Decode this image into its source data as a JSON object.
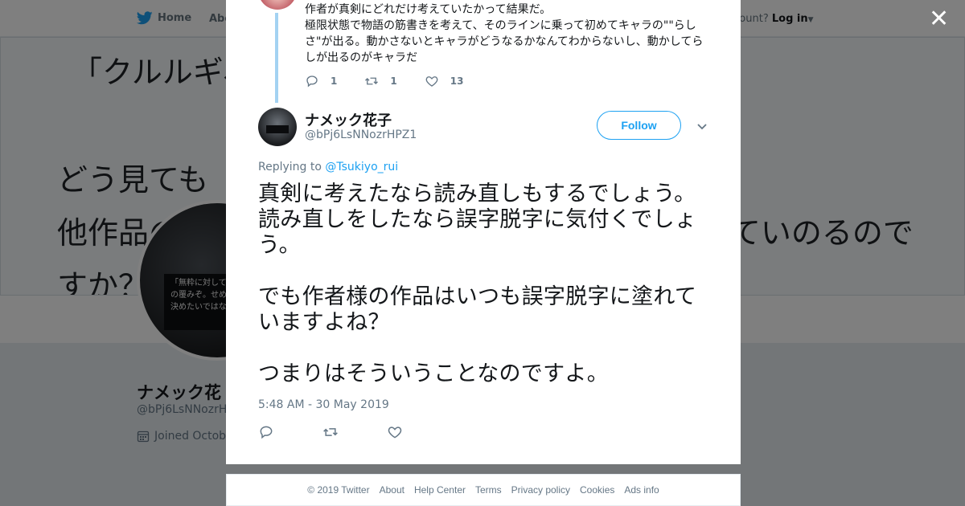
{
  "topbar": {
    "home_label": "Home",
    "about_label": "Abo",
    "account_prompt": "ccount?",
    "login_label": "Log in"
  },
  "background": {
    "banner_lines": [
      "「クルルギ、",
      "どう見ても",
      "他作品の",
      "していのるので",
      "すか？"
    ],
    "avatar_caption": "「無粋に対して\nの覆みぞ。せめ\n決めたいではな",
    "profile_name": "ナメック花",
    "profile_handle": "@bPj6LsNNozrHP",
    "joined_text": "Joined Octobe"
  },
  "previous_tweet": {
    "text": "作者が真剣にどれだけ考えていたかって結果だ。\n極限状態で物語の筋書きを考えて、そのラインに乗って初めてキャラの\"\"らしさ\"が出る。動かさないとキャラがどうなるかなんてわからないし、動かしてらしが出るのがキャラだ",
    "reply_count": "1",
    "retweet_count": "1",
    "like_count": "13"
  },
  "tweet": {
    "author_name": "ナメック花子",
    "author_handle": "@bPj6LsNNozrHPZ1",
    "follow_label": "Follow",
    "replying_prefix": "Replying to",
    "replying_to": "@Tsukiyo_rui",
    "text": "真剣に考えたなら読み直しもするでしょう。\n読み直しをしたなら誤字脱字に気付くでしょう。\n\nでも作者様の作品はいつも誤字脱字に塗れていますよね？\n\nつまりはそういうことなのですよ。",
    "timestamp": "5:48 AM - 30 May 2019"
  },
  "footer": {
    "copyright": "© 2019 Twitter",
    "links": [
      "About",
      "Help Center",
      "Terms",
      "Privacy policy",
      "Cookies",
      "Ads info"
    ]
  },
  "colors": {
    "accent": "#1da1f2",
    "thread_line": "#a3d2f2",
    "muted": "#657786",
    "text": "#14171a"
  },
  "icons": [
    "twitter-bird-icon",
    "close-icon",
    "reply-icon",
    "retweet-icon",
    "like-icon",
    "chevron-down-icon",
    "calendar-icon",
    "caret-down-icon"
  ]
}
